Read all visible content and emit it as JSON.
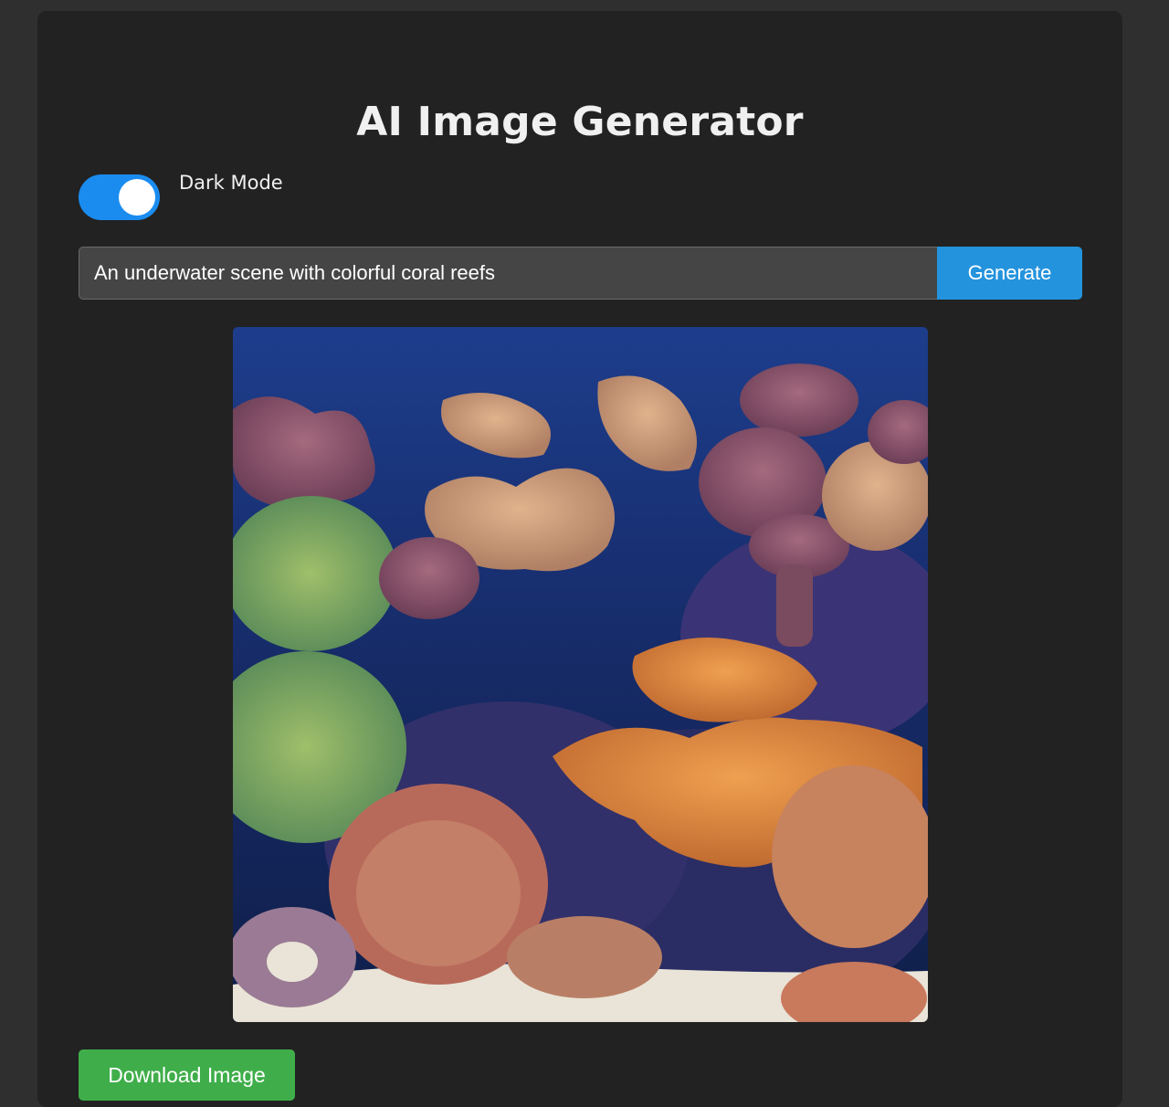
{
  "header": {
    "title": "AI Image Generator"
  },
  "dark_mode": {
    "label": "Dark Mode",
    "enabled": true
  },
  "prompt": {
    "value": "An underwater scene with colorful coral reefs",
    "placeholder": ""
  },
  "actions": {
    "generate_label": "Generate",
    "download_label": "Download Image"
  },
  "colors": {
    "page_background": "#2f2f2f",
    "card_background": "#222222",
    "toggle_on": "#1a8cf0",
    "generate_button": "#2493dd",
    "download_button": "#3fae4a"
  }
}
